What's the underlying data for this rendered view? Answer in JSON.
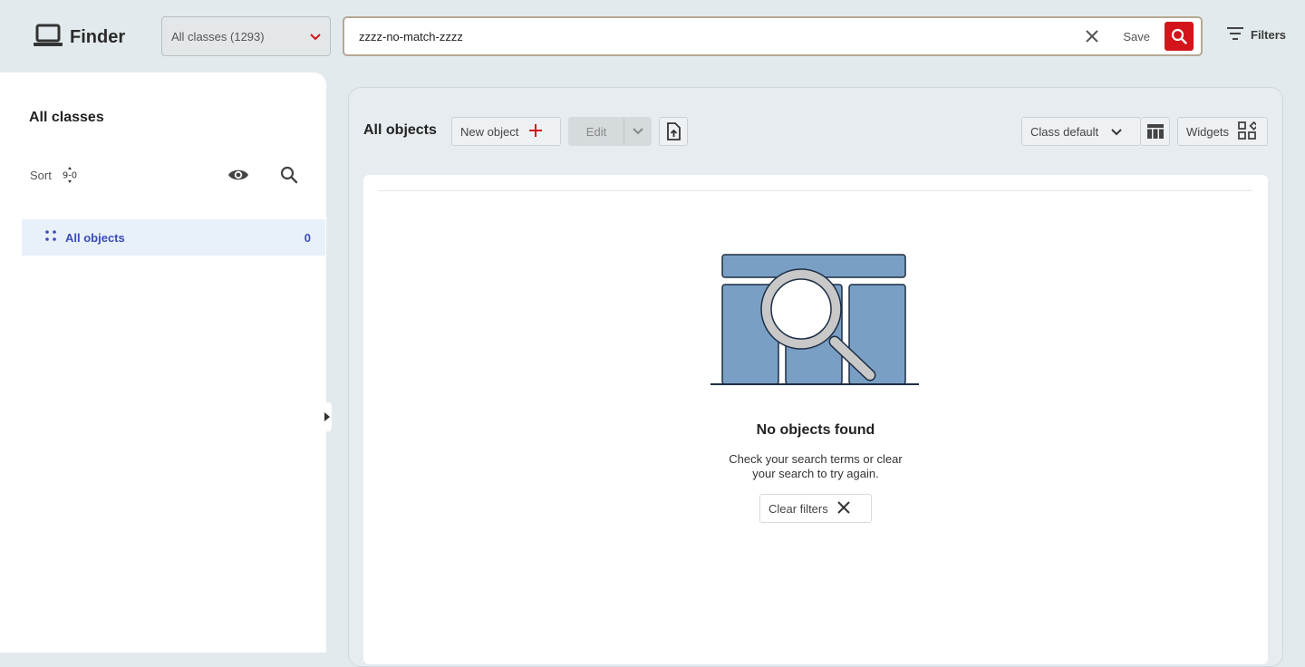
{
  "app": {
    "title": "Finder",
    "brand_icon": "laptop-icon"
  },
  "header": {
    "class_select": {
      "value": "All classes (1293)"
    },
    "search": {
      "value": "zzzz-no-match-zzzz",
      "save_label": "Save"
    },
    "filters_label": "Filters"
  },
  "sidebar": {
    "title": "All classes",
    "sort_label": "Sort",
    "sort_icon_text": "9-0",
    "items": [
      {
        "label": "All objects",
        "count": "0"
      }
    ]
  },
  "toolbar": {
    "title": "All objects",
    "new_object_label": "New object",
    "edit_label": "Edit",
    "view_label": "Class default",
    "widgets_label": "Widgets"
  },
  "empty_state": {
    "title": "No objects found",
    "message": "Check your search terms or clear your search to try again.",
    "clear_filters_label": "Clear filters"
  },
  "colors": {
    "accent_red": "#d3141a",
    "selection_blue": "#3b4cb8",
    "illustration_fill": "#7a9fc5"
  }
}
